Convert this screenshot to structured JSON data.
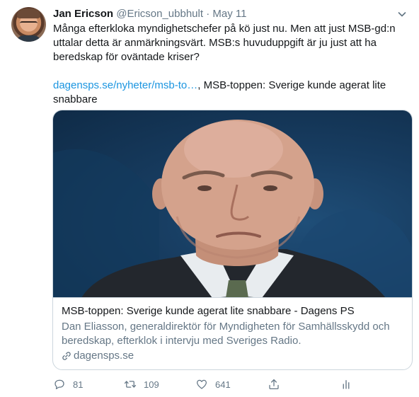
{
  "tweet": {
    "author_name": "Jan Ericson",
    "author_handle": "@Ericson_ubbhult",
    "separator": "·",
    "date": "May 11",
    "text_paragraph": "Många efterkloka myndighetschefer på kö just nu. Men att just MSB-gd:n uttalar detta är anmärkningsvärt. MSB:s huvuduppgift är ju just att ha beredskap för oväntade kriser?",
    "link_text": "dagensps.se/nyheter/msb-to…",
    "link_suffix": ", MSB-toppen: Sverige kunde agerat lite snabbare"
  },
  "card": {
    "title": "MSB-toppen: Sverige kunde agerat lite snabbare - Dagens PS",
    "description": "Dan Eliasson, generaldirektör för Myndigheten för Samhällsskydd och beredskap, efterklok i intervju med Sveriges Radio.",
    "domain": "dagensps.se"
  },
  "actions": {
    "reply_count": "81",
    "retweet_count": "109",
    "like_count": "641"
  },
  "icons": {
    "caret": "chevron-down-icon",
    "reply": "comment-icon",
    "retweet": "retweet-icon",
    "like": "heart-icon",
    "share": "share-icon",
    "analytics": "analytics-icon",
    "link": "link-icon"
  },
  "colors": {
    "link": "#1b95e0",
    "secondary_text": "#657786",
    "primary_text": "#14171a",
    "border": "#ccd6dd"
  }
}
